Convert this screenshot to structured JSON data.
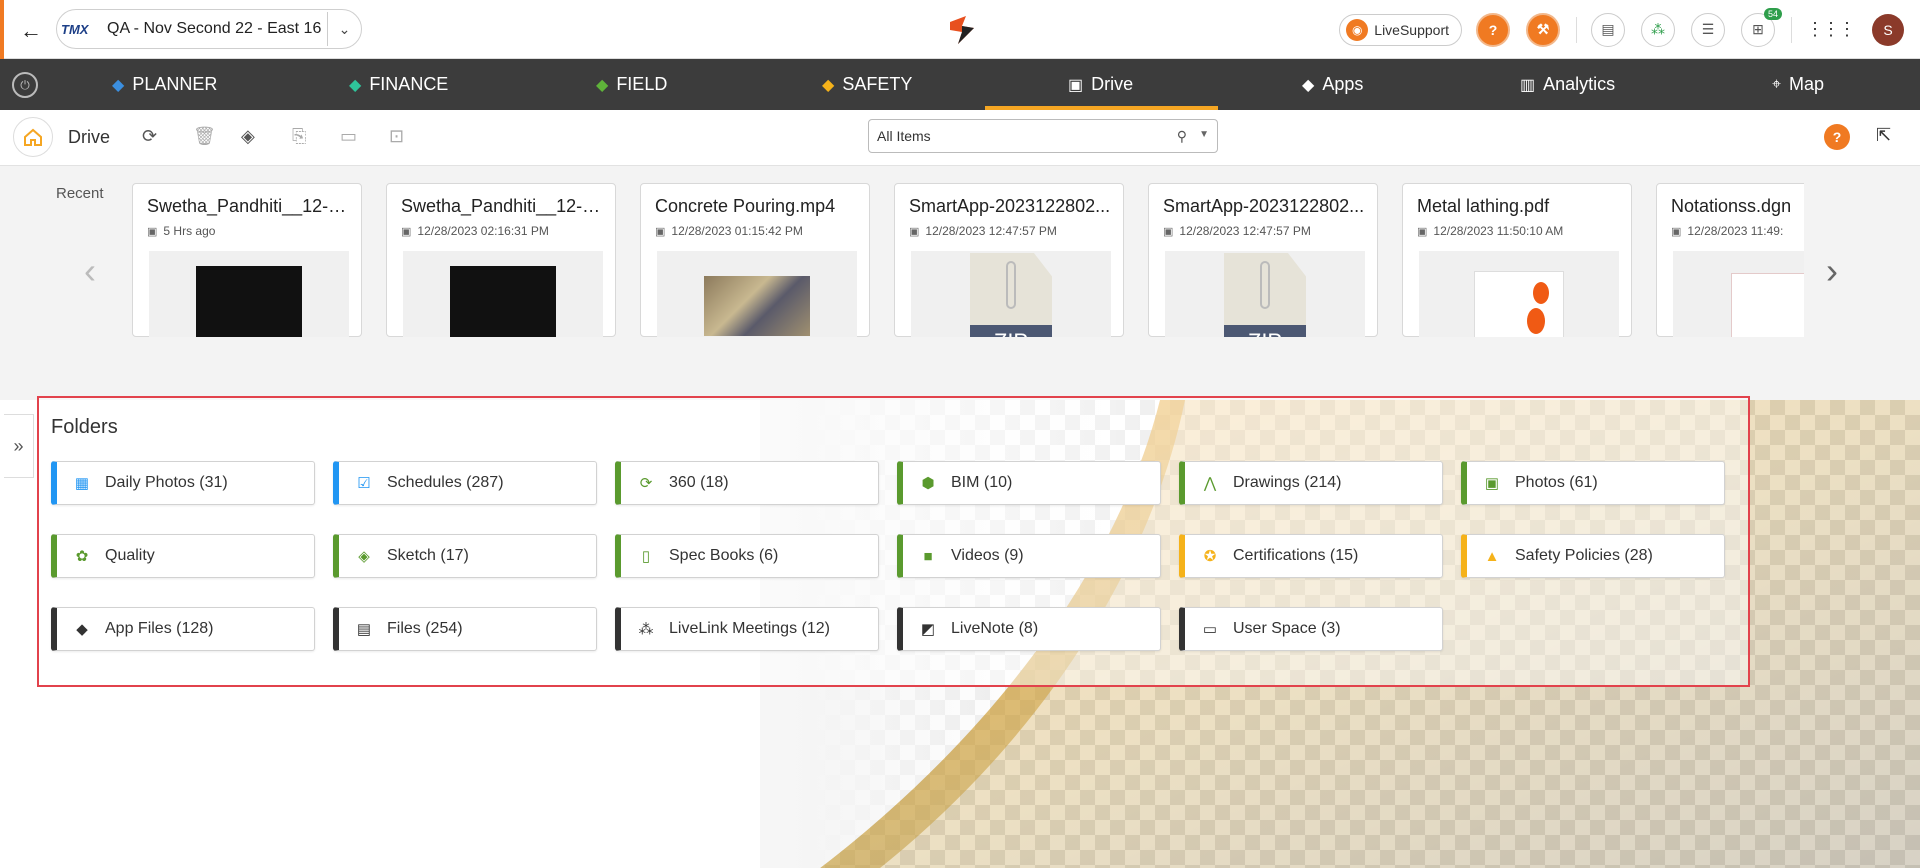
{
  "header": {
    "project_logo": "TMX",
    "project_name": "QA - Nov Second 22 - East 16",
    "live_support": "LiveSupport",
    "cart_badge": "54",
    "avatar_initial": "S"
  },
  "nav": {
    "items": [
      {
        "label": "PLANNER"
      },
      {
        "label": "FINANCE"
      },
      {
        "label": "FIELD"
      },
      {
        "label": "SAFETY"
      },
      {
        "label": "Drive"
      },
      {
        "label": "Apps"
      },
      {
        "label": "Analytics"
      },
      {
        "label": "Map"
      }
    ],
    "active": "Drive"
  },
  "toolbar": {
    "title": "Drive",
    "filter_value": "All Items"
  },
  "recent": {
    "label": "Recent",
    "cards": [
      {
        "title": "Swetha_Pandhiti__12-2...",
        "time": "5 Hrs ago",
        "thumb": "video"
      },
      {
        "title": "Swetha_Pandhiti__12-2...",
        "time": "12/28/2023 02:16:31 PM",
        "thumb": "video"
      },
      {
        "title": "Concrete Pouring.mp4",
        "time": "12/28/2023 01:15:42 PM",
        "thumb": "photo"
      },
      {
        "title": "SmartApp-2023122802...",
        "time": "12/28/2023 12:47:57 PM",
        "thumb": "zip"
      },
      {
        "title": "SmartApp-2023122802...",
        "time": "12/28/2023 12:47:57 PM",
        "thumb": "zip"
      },
      {
        "title": "Metal lathing.pdf",
        "time": "12/28/2023 11:50:10 AM",
        "thumb": "pdf"
      },
      {
        "title": "Notationss.dgn",
        "time": "12/28/2023 11:49:",
        "thumb": "dgn"
      }
    ],
    "zip_label": "ZIP"
  },
  "folders": {
    "title": "Folders",
    "items": [
      {
        "label": "Daily Photos (31)",
        "color": "#2196f3",
        "icon": "calendar-photo-icon",
        "glyph": "▦"
      },
      {
        "label": "Schedules (287)",
        "color": "#2196f3",
        "icon": "calendar-check-icon",
        "glyph": "☑"
      },
      {
        "label": "360 (18)",
        "color": "#5a9a2e",
        "icon": "rotate-360-icon",
        "glyph": "⟳"
      },
      {
        "label": "BIM (10)",
        "color": "#5a9a2e",
        "icon": "cube-icon",
        "glyph": "⬢"
      },
      {
        "label": "Drawings (214)",
        "color": "#5a9a2e",
        "icon": "compass-icon",
        "glyph": "⋀"
      },
      {
        "label": "Photos (61)",
        "color": "#5a9a2e",
        "icon": "image-icon",
        "glyph": "▣"
      },
      {
        "label": "Quality",
        "color": "#5a9a2e",
        "icon": "gear-badge-icon",
        "glyph": "✿"
      },
      {
        "label": "Sketch (17)",
        "color": "#5a9a2e",
        "icon": "sketch-icon",
        "glyph": "◈"
      },
      {
        "label": "Spec Books (6)",
        "color": "#5a9a2e",
        "icon": "book-icon",
        "glyph": "▯"
      },
      {
        "label": "Videos (9)",
        "color": "#5a9a2e",
        "icon": "video-camera-icon",
        "glyph": "■"
      },
      {
        "label": "Certifications (15)",
        "color": "#f5b21a",
        "icon": "certificate-icon",
        "glyph": "✪"
      },
      {
        "label": "Safety Policies (28)",
        "color": "#f5b21a",
        "icon": "cone-icon",
        "glyph": "▲"
      },
      {
        "label": "App Files (128)",
        "color": "#333333",
        "icon": "apps-logo-icon",
        "glyph": "◆"
      },
      {
        "label": "Files (254)",
        "color": "#333333",
        "icon": "document-icon",
        "glyph": "▤"
      },
      {
        "label": "LiveLink Meetings (12)",
        "color": "#333333",
        "icon": "meeting-icon",
        "glyph": "⁂"
      },
      {
        "label": "LiveNote (8)",
        "color": "#333333",
        "icon": "note-image-icon",
        "glyph": "◩"
      },
      {
        "label": "User Space (3)",
        "color": "#333333",
        "icon": "drive-icon",
        "glyph": "▭"
      }
    ]
  }
}
